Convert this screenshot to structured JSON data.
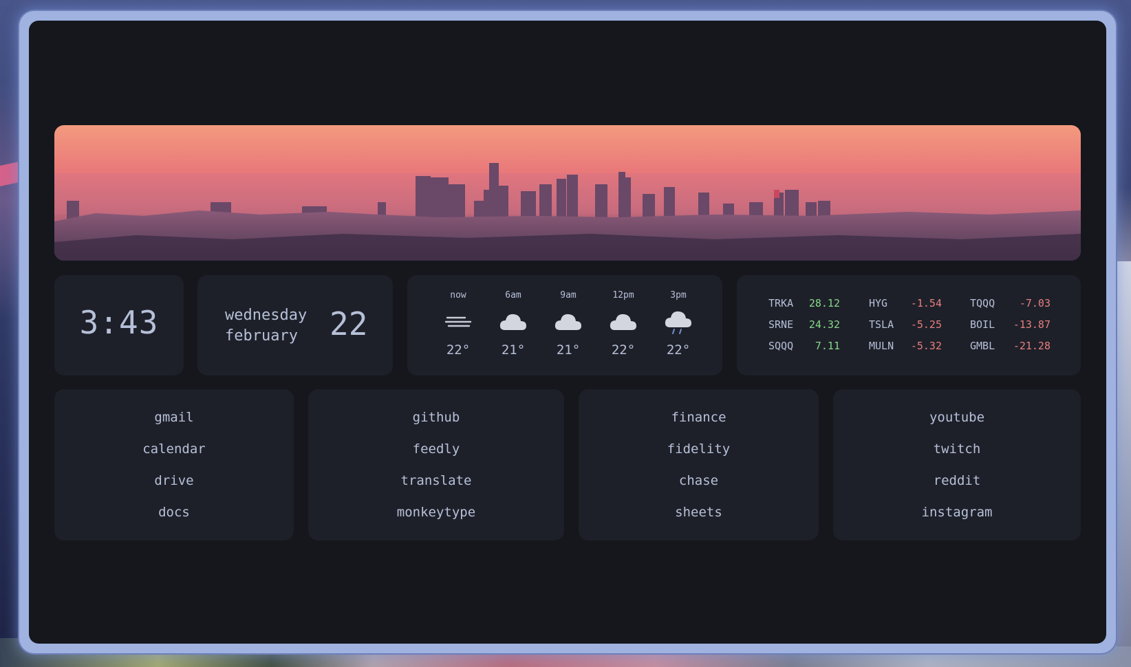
{
  "clock": {
    "time": "3:43"
  },
  "date": {
    "weekday": "wednesday",
    "month": "february",
    "day": "22"
  },
  "weather": [
    {
      "time": "now",
      "icon": "fog-icon",
      "temp": "22°"
    },
    {
      "time": "6am",
      "icon": "cloud-icon",
      "temp": "21°"
    },
    {
      "time": "9am",
      "icon": "cloud-icon",
      "temp": "21°"
    },
    {
      "time": "12pm",
      "icon": "cloud-icon",
      "temp": "22°"
    },
    {
      "time": "3pm",
      "icon": "rain-cloud-icon",
      "temp": "22°"
    }
  ],
  "stocks": [
    {
      "ticker": "TRKA",
      "value": "28.12",
      "trend": "up"
    },
    {
      "ticker": "HYG",
      "value": "-1.54",
      "trend": "down"
    },
    {
      "ticker": "TQQQ",
      "value": "-7.03",
      "trend": "down"
    },
    {
      "ticker": "SRNE",
      "value": "24.32",
      "trend": "up"
    },
    {
      "ticker": "TSLA",
      "value": "-5.25",
      "trend": "down"
    },
    {
      "ticker": "BOIL",
      "value": "-13.87",
      "trend": "down"
    },
    {
      "ticker": "SQQQ",
      "value": "7.11",
      "trend": "up"
    },
    {
      "ticker": "MULN",
      "value": "-5.32",
      "trend": "down"
    },
    {
      "ticker": "GMBL",
      "value": "-21.28",
      "trend": "down"
    }
  ],
  "link_groups": [
    {
      "links": [
        "gmail",
        "calendar",
        "drive",
        "docs"
      ]
    },
    {
      "links": [
        "github",
        "feedly",
        "translate",
        "monkeytype"
      ]
    },
    {
      "links": [
        "finance",
        "fidelity",
        "chase",
        "sheets"
      ]
    },
    {
      "links": [
        "youtube",
        "twitch",
        "reddit",
        "instagram"
      ]
    }
  ],
  "colors": {
    "background": "#15171c",
    "card": "#1e2029",
    "text": "#b6c0d8",
    "positive": "#86d98a",
    "negative": "#e87f7f",
    "frame": "#9fb2e0"
  }
}
